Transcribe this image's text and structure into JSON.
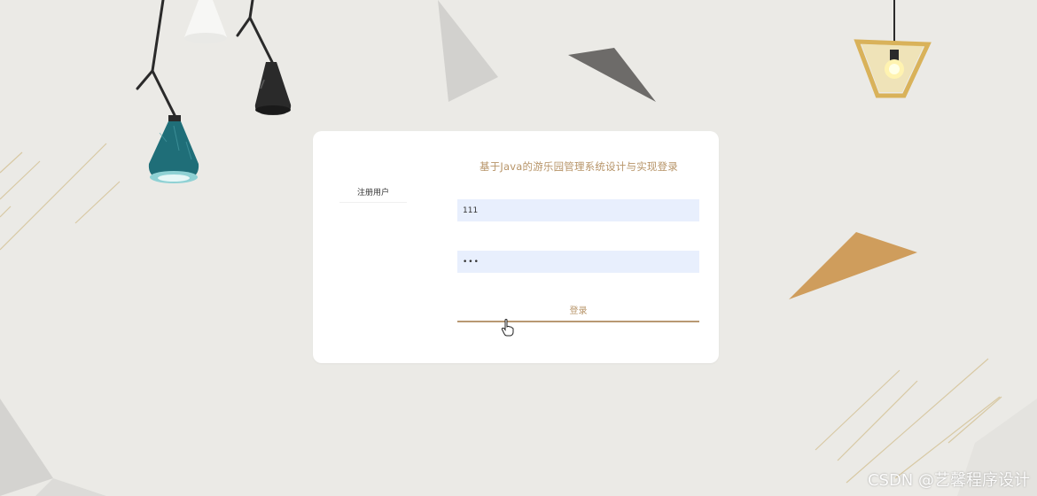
{
  "login": {
    "title": "基于Java的游乐园管理系统设计与实现登录",
    "register_label": "注册用户",
    "username_value": "111",
    "password_value": "111",
    "login_label": "登录"
  },
  "watermark": {
    "text": "CSDN @艺馨程序设计"
  },
  "colors": {
    "background": "#ebeae6",
    "accent": "#b79468",
    "input_bg": "#e8effd",
    "lamp_teal": "#1f6e78",
    "lamp_black": "#2b2b2b",
    "lamp_gold": "#d9b25a",
    "triangle_orange": "#c99a55"
  },
  "icons": [
    "pendant-lamp-teal-icon",
    "pendant-lamp-white-icon",
    "pendant-lamp-black-icon",
    "pendant-lamp-gold-icon",
    "hand-cursor-icon"
  ]
}
